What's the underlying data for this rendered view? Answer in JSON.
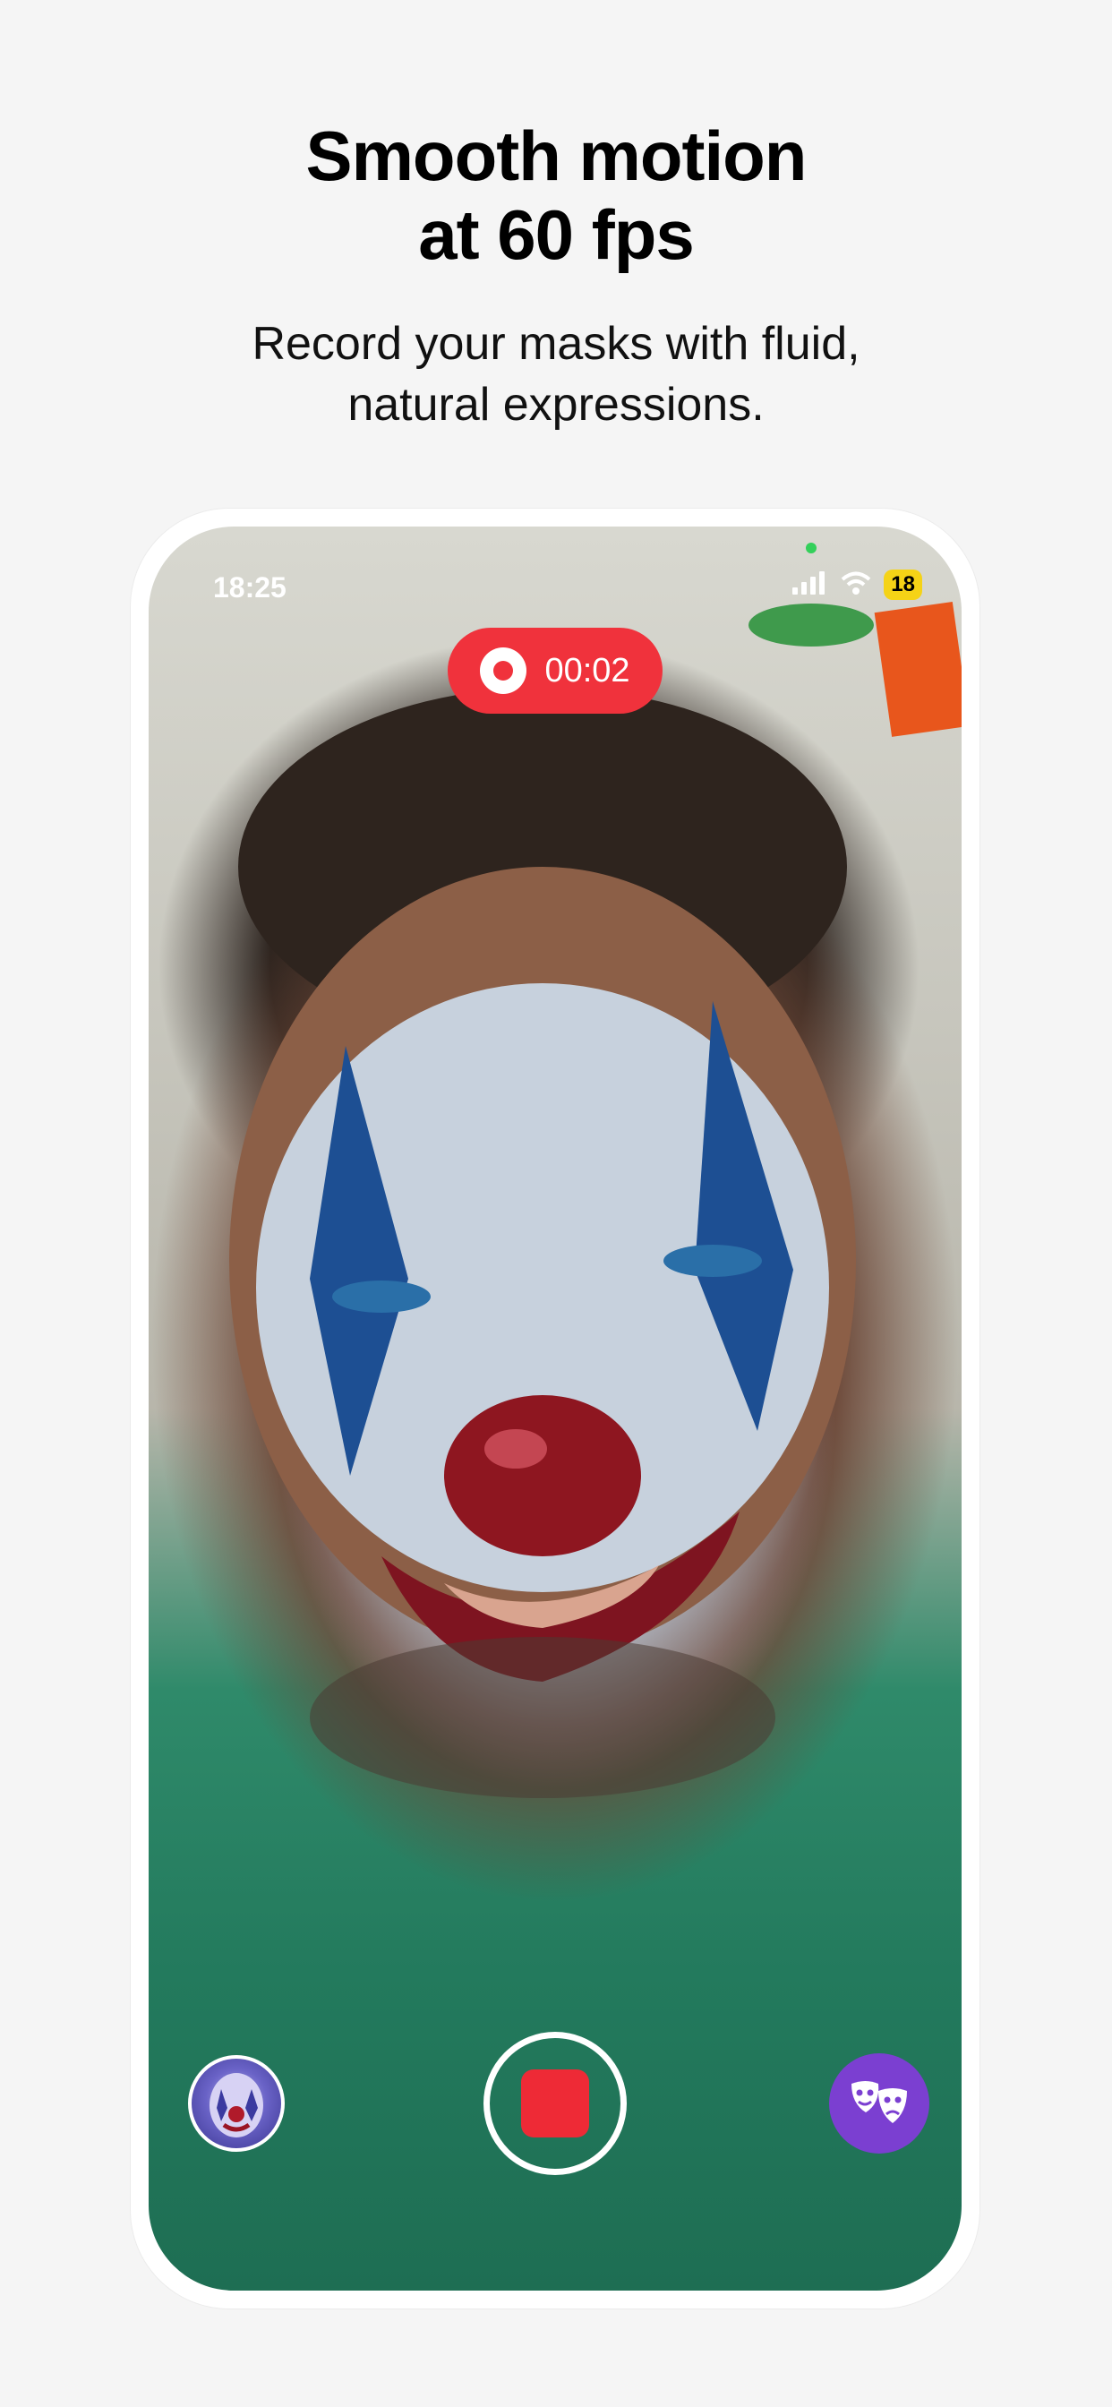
{
  "headline": {
    "line1": "Smooth motion",
    "line2": "at 60 fps"
  },
  "subline": {
    "line1": "Record your masks with fluid,",
    "line2": "natural expressions."
  },
  "status_bar": {
    "time": "18:25",
    "battery": "18",
    "signal_icon": "cellular-signal-icon",
    "wifi_icon": "wifi-icon"
  },
  "recording": {
    "timer": "00:02",
    "indicator_icon": "record-indicator-icon"
  },
  "controls": {
    "left_icon": "mask-thumbnail-icon",
    "center_icon": "stop-record-icon",
    "right_icon": "theater-masks-icon"
  },
  "colors": {
    "accent_red": "#f0323c",
    "accent_purple": "#7b3fd1",
    "background": "#f5f5f5"
  }
}
